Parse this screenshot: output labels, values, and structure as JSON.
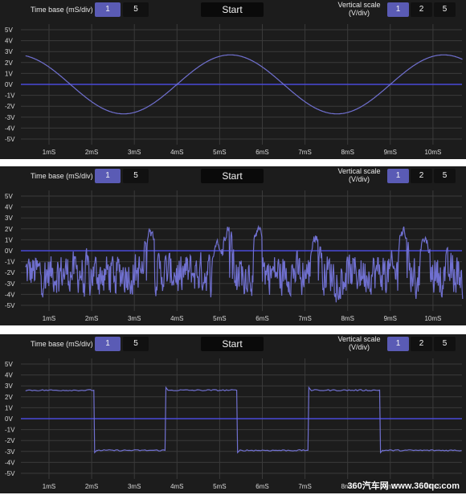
{
  "colors": {
    "accent": "#5a5bb5",
    "trace": "#7070d0",
    "zero_line": "#4a4ad8",
    "grid": "#3a3a3a",
    "background": "#1c1c1c"
  },
  "controls": {
    "time_base_label": "Time base (mS/div)",
    "time_base_options": [
      "1",
      "5"
    ],
    "time_base_selected": "1",
    "start_label": "Start",
    "vertical_scale_label_line1": "Vertical scale",
    "vertical_scale_label_line2": "(V/div)",
    "vertical_scale_options": [
      "1",
      "2",
      "5"
    ],
    "vertical_scale_selected": "1"
  },
  "y_ticks": [
    "5V",
    "4V",
    "3V",
    "2V",
    "1V",
    "0V",
    "-1V",
    "-2V",
    "-3V",
    "-4V",
    "-5V"
  ],
  "x_ticks": [
    "1mS",
    "2mS",
    "3mS",
    "4mS",
    "5mS",
    "6mS",
    "7mS",
    "8mS",
    "9mS",
    "10mS"
  ],
  "panels": [
    {
      "signal": "sine"
    },
    {
      "signal": "noise"
    },
    {
      "signal": "square"
    }
  ],
  "watermark": "360汽车网 www.360qc.com",
  "chart_data": [
    {
      "type": "line",
      "series": [
        {
          "shape": "sine",
          "amplitude_v": 2.7,
          "period_ms": 5.0,
          "peak_at_ms": 0.25,
          "offset_v": 0
        }
      ],
      "x_range_ms": [
        0.45,
        10.7
      ],
      "ylim": [
        -5.5,
        5.5
      ],
      "grid": true
    },
    {
      "type": "line",
      "series": [
        {
          "shape": "noise",
          "mean_v": -2.0,
          "range_v": [
            -5.2,
            2.2
          ]
        }
      ],
      "x_range_ms": [
        0.45,
        10.7
      ],
      "ylim": [
        -5.5,
        5.5
      ],
      "grid": true
    },
    {
      "type": "line",
      "series": [
        {
          "shape": "square",
          "high_v": 2.6,
          "low_v": -2.9,
          "period_ms": 3.35,
          "rising_edges_ms": [
            0.38,
            3.72,
            7.07
          ],
          "falling_edges_ms": [
            2.05,
            5.4,
            8.75
          ]
        }
      ],
      "x_range_ms": [
        0.45,
        10.7
      ],
      "ylim": [
        -5.5,
        5.5
      ],
      "grid": true
    }
  ]
}
